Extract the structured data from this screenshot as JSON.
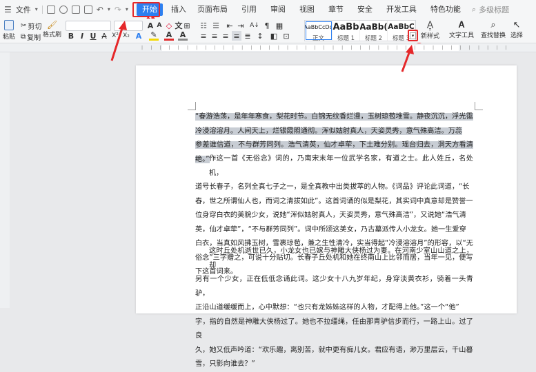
{
  "menu": {
    "file": "文件",
    "tabs": [
      "开始",
      "插入",
      "页面布局",
      "引用",
      "审阅",
      "视图",
      "章节",
      "安全",
      "开发工具",
      "特色功能"
    ],
    "search_placeholder": "多级标题",
    "badge1": "1",
    "badge2": "2"
  },
  "ribbon": {
    "paste": "粘贴",
    "cut": "剪切",
    "copy": "复制",
    "format_painter": "格式刷",
    "bold": "B",
    "italic": "I",
    "underline": "U",
    "font_color_a": "A",
    "styles": [
      {
        "preview": "AaBbCcDd",
        "name": "正文"
      },
      {
        "preview": "AaBb",
        "name": "标题 1"
      },
      {
        "preview": "AaBb(",
        "name": "标题 2"
      },
      {
        "preview": "AaBbC",
        "name": "标题 3"
      }
    ],
    "new_style": "新样式",
    "text_tools": "文字工具",
    "find_replace": "查找替换",
    "select": "选择"
  },
  "document": {
    "quote_lines": [
      "“春游浩荡，是年年寒食，梨花时节。白锦无纹香烂漫，玉树琼苞堆雪。静夜沉沉，浮光霭",
      "冷浸溶溶月。人间天上，烂银霞照通彻。浑似姑射真人，天姿灵秀，意气殊高洁。万蕊",
      "参差谁信道，不与群芳同列。浩气清英，仙才卓荦，下土难分别。瑶台归去，洞天方看清绝。”"
    ],
    "para1": [
      "作这一首《无俗念》词的，乃南宋末年一位武学名家，有道之士。此人姓丘，名处机，",
      "道号长春子，名列全真七子之一，是全真教中出类拔萃的人物。《词品》评论此词道，“长",
      "春，世之所谓仙人也，而词之清拔如此”。这首词诵的似是梨花，其实词中真意却是赞誉一",
      "位身穿白衣的美貌少女，说她“浑似姑射真人，天姿灵秀，意气殊高洁”，又说她“浩气清",
      "英，仙才卓荦”，“不与群芳同列”。词中所颂这美女，乃古墓派传人小龙女。她一生爱穿",
      "白衣，当真如风拂玉树，雪裹琼苞，兼之生性清冷，实当得起“冷浸溶溶月”的形容，以“无",
      "俗念”三字赠之，可说十分贴切。长春子丘处机和她在终南山上比邻而居，当年一见，便写",
      "下这首词来。"
    ],
    "para2": [
      "这时丘处机逝世已久，小龙女也已嫁与神雕大侠杨过为妻。在河南少室山山道之上，却",
      "另有一个少女，正在低低念诵此词。这少女十八九岁年纪，身穿淡黄衣衫，骑着一头青驴，",
      "正沿山道缓缓而上，心中默想：“也只有龙姊姊这样的人物，才配得上他。”这一个“他”",
      "字，指的自然是神雕大侠杨过了。她也不拉缰绳，任由那青驴信步而行，一路上山。过了良",
      "久，她又低声吟道：“欢乐趣，离别苦，就中更有痴儿女。君应有语，渺万里层云，千山暮",
      "雪，只影向谁去？”"
    ]
  }
}
